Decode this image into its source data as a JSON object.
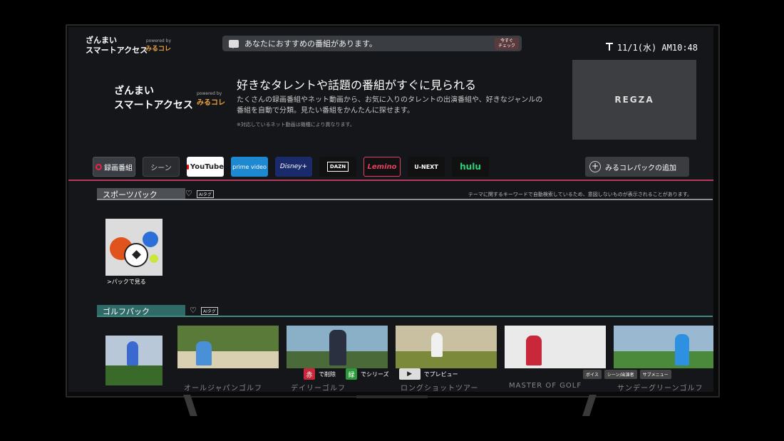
{
  "header": {
    "app_title_line1": "ざんまい",
    "app_title_line2": "スマートアクセス",
    "powered_by": "powered by",
    "powered_logo": "みるコレ",
    "notice_text": "あなたにおすすめの番組があります。",
    "check_button_line1": "今すぐ",
    "check_button_line2": "チェック",
    "clock": "11/1(水) AM10:48"
  },
  "hero": {
    "logo_line1": "ざんまい",
    "logo_line2": "スマートアクセス",
    "powered_by": "powered by",
    "powered_logo": "みるコレ",
    "title": "好きなタレントや話題の番組がすぐに見られる",
    "desc": "たくさんの録画番組やネット動画から、お気に入りのタレントの出演番組や、好きなジャンルの番組を自動で分類。見たい番組をかんたんに探せます。",
    "note": "※対応しているネット動画は機種により異なります。",
    "brand": "REGZA"
  },
  "tabs": {
    "recorded": "録画番組",
    "scene": "シーン",
    "youtube": "YouTube",
    "prime": "prime video",
    "disney": "Disney+",
    "dazn": "DAZN",
    "lemino": "Lemino",
    "unext": "U-NEXT",
    "hulu": "hulu",
    "add_pack": "みるコレパックの追加"
  },
  "sports": {
    "title": "スポーツパック",
    "ai_badge": "AIタグ",
    "theme_note": "テーマに関するキーワードで自動検索しているため、意図しないものが表示されることがあります。",
    "pack_link": ">パックで見る"
  },
  "golf": {
    "title": "ゴルフパック",
    "ai_badge": "AIタグ",
    "captions": [
      "オールジャパンゴルフ",
      "デイリーゴルフ",
      "ロングショットツアー",
      "MASTER OF GOLF",
      "サンデーグリーンゴルフ"
    ]
  },
  "controls": {
    "red_key": "赤",
    "red_label": "で削除",
    "green_key": "緑",
    "green_label": "でシリーズ",
    "play_label": "でプレビュー",
    "voice": "ボイス",
    "scene_list": "シーン/出演者",
    "submenu": "サブメニュー"
  }
}
